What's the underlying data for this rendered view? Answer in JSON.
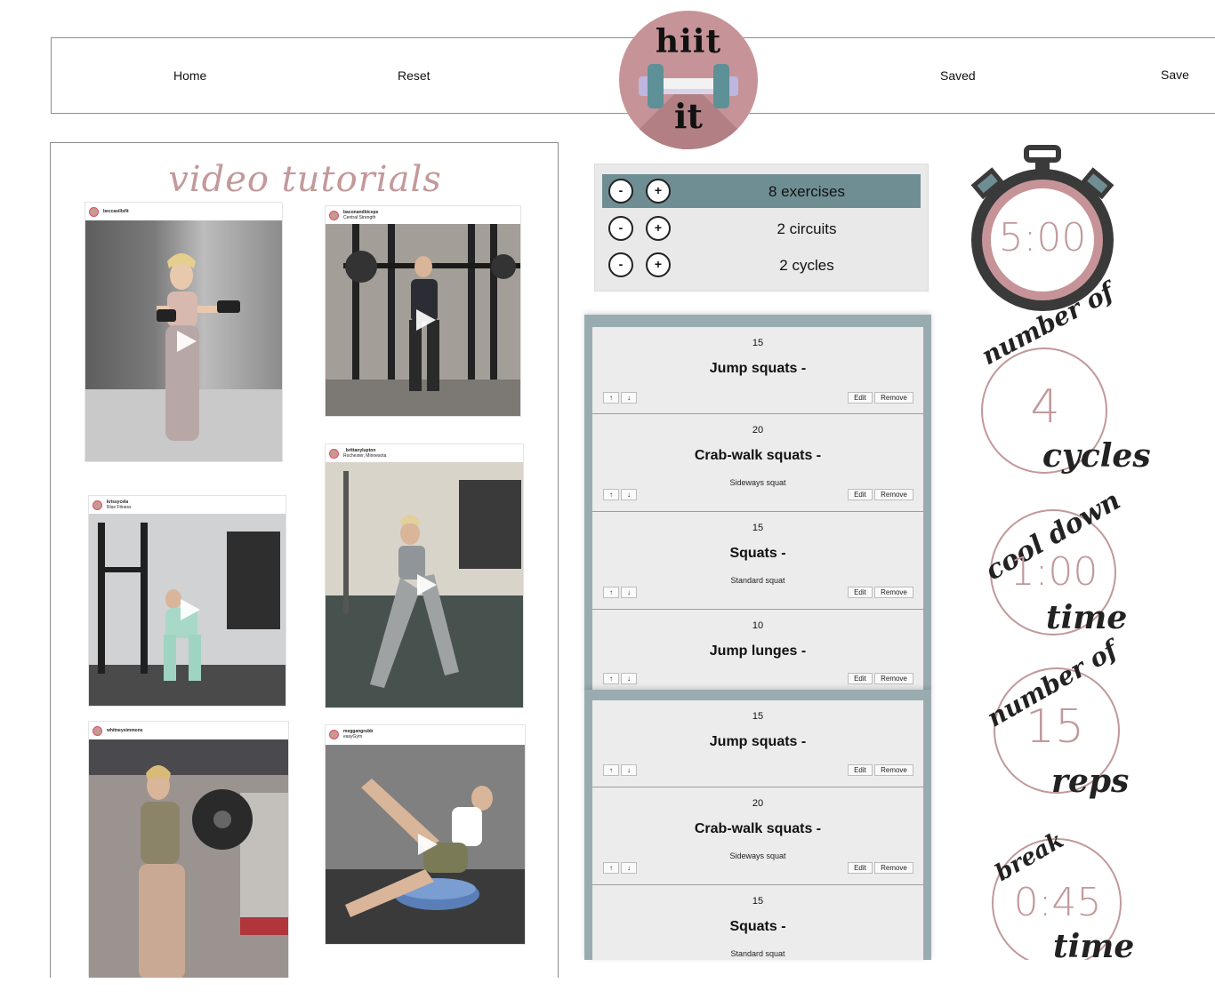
{
  "nav": {
    "home": "Home",
    "reset": "Reset",
    "saved": "Saved",
    "save": "Save"
  },
  "logo": {
    "top": "hiit",
    "bottom": "it"
  },
  "videos": {
    "title": "video tutorials",
    "cards": [
      {
        "user": "beccasillsfit",
        "location": ""
      },
      {
        "user": "baconandbiceps",
        "location": "Central Strength"
      },
      {
        "user": "krissycela",
        "location": "Rise Fitness"
      },
      {
        "user": "_brittanylupton",
        "location": "Rochester, Minnesota"
      },
      {
        "user": "whitneysimmons",
        "location": ""
      },
      {
        "user": "meggangrubb",
        "location": "easyGym"
      }
    ]
  },
  "settings": {
    "minus": "-",
    "plus": "+",
    "rows": [
      {
        "label": "8 exercises"
      },
      {
        "label": "2 circuits"
      },
      {
        "label": "2 cycles"
      }
    ]
  },
  "exercise_lists": [
    [
      {
        "reps": "15",
        "name": "Jump squats -",
        "desc": ""
      },
      {
        "reps": "20",
        "name": "Crab-walk squats -",
        "desc": "Sideways squat"
      },
      {
        "reps": "15",
        "name": "Squats -",
        "desc": "Standard squat"
      },
      {
        "reps": "10",
        "name": "Jump lunges -",
        "desc": ""
      }
    ],
    [
      {
        "reps": "15",
        "name": "Jump squats -",
        "desc": ""
      },
      {
        "reps": "20",
        "name": "Crab-walk squats -",
        "desc": "Sideways squat"
      },
      {
        "reps": "15",
        "name": "Squats -",
        "desc": "Standard squat"
      }
    ]
  ],
  "controls": {
    "up": "↑",
    "down": "↓",
    "edit": "Edit",
    "remove": "Remove"
  },
  "timers": {
    "stopwatch": "5:00",
    "cycles": {
      "top": "number of",
      "value": "4",
      "bottom": "cycles"
    },
    "cooldown": {
      "top": "cool down",
      "value": "1:00",
      "bottom": "time"
    },
    "reps": {
      "top": "number of",
      "value": "15",
      "bottom": "reps"
    },
    "break": {
      "top": "break",
      "value": "0:45",
      "bottom": "time"
    }
  },
  "colors": {
    "accent": "#c1999b",
    "teal": "#6f8e93",
    "panel": "#e9e9e9"
  }
}
